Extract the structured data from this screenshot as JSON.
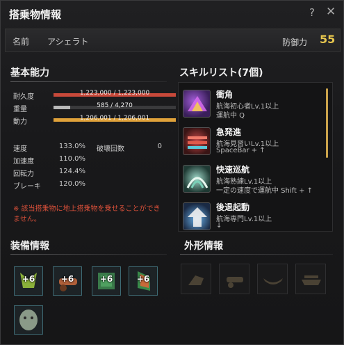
{
  "window": {
    "title": "搭乗物情報",
    "help": "?",
    "close": "✕"
  },
  "header": {
    "name_label": "名前",
    "name_value": "アシェラト",
    "defense_label": "防御力",
    "defense_value": "55"
  },
  "basic": {
    "title": "基本能力",
    "bars": [
      {
        "label": "耐久度",
        "text": "1,223,000 / 1,223,000",
        "fraction": 1.0,
        "color": "#c8493a"
      },
      {
        "label": "重量",
        "text": "585 / 4,270",
        "fraction": 0.137,
        "color": "#b8b8b8"
      },
      {
        "label": "動力",
        "text": "1,206,001 / 1,206,001",
        "fraction": 1.0,
        "color": "#e0a23a"
      }
    ],
    "stats": [
      {
        "label": "速度",
        "value": "133.0%"
      },
      {
        "label": "加速度",
        "value": "110.0%"
      },
      {
        "label": "回転力",
        "value": "124.4%"
      },
      {
        "label": "ブレーキ",
        "value": "120.0%"
      }
    ],
    "extra": {
      "label": "破壊回数",
      "value": "0"
    },
    "warning": "※ 該当搭乗物に地上搭乗物を乗せることができません。"
  },
  "skills": {
    "title": "スキルリスト(7個)",
    "items": [
      {
        "name": "衝角",
        "line1": "航海初心者Lv.1以上",
        "line2": "運航中 Q",
        "icon": "ram-icon"
      },
      {
        "name": "急発進",
        "line1": "航海見習いLv.1以上",
        "line2": "SpaceBar + ↑",
        "icon": "boost-icon"
      },
      {
        "name": "快速巡航",
        "line1": "航海熟練Lv.1以上",
        "line2": "一定の速度で運航中 Shift + ↑",
        "icon": "cruise-icon"
      },
      {
        "name": "後退起動",
        "line1": "航海専門Lv.1以上",
        "line2": "↓",
        "icon": "reverse-icon"
      }
    ]
  },
  "equipment": {
    "title": "装備情報",
    "slots": [
      {
        "plus": "+6",
        "icon": "figurehead-icon"
      },
      {
        "plus": "+6",
        "icon": "cannon-icon"
      },
      {
        "plus": "+6",
        "icon": "plating-icon"
      },
      {
        "plus": "+6",
        "icon": "sail-icon"
      },
      {
        "plus": "",
        "icon": "sailor-icon"
      }
    ]
  },
  "appearance": {
    "title": "外形情報",
    "slots": [
      "figurehead-outline-icon",
      "cannon-outline-icon",
      "plating-outline-icon",
      "hull-outline-icon"
    ]
  }
}
